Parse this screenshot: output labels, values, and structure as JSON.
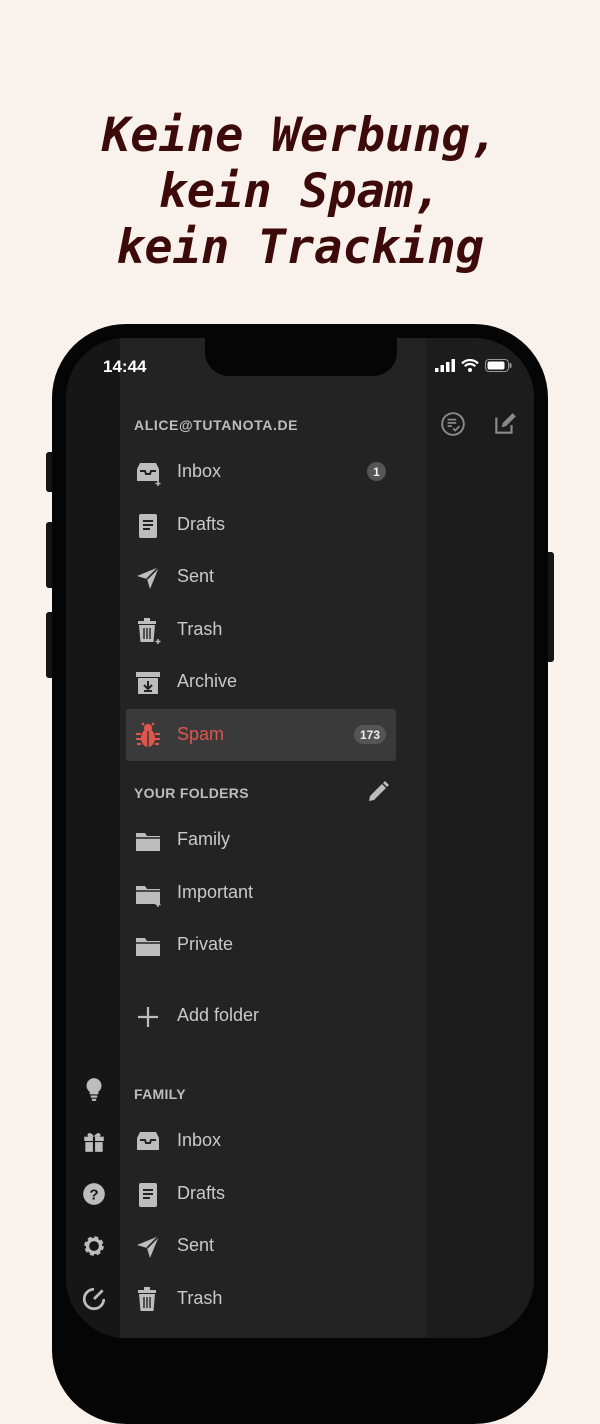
{
  "headline": {
    "line1": "Keine Werbung,",
    "line2": "kein Spam,",
    "line3": "kein Tracking"
  },
  "status_bar": {
    "time": "14:44"
  },
  "account": {
    "email": "ALICE@TUTANOTA.DE"
  },
  "system_folders": [
    {
      "label": "Inbox",
      "icon": "inbox-icon",
      "badge": "1"
    },
    {
      "label": "Drafts",
      "icon": "drafts-icon"
    },
    {
      "label": "Sent",
      "icon": "sent-icon"
    },
    {
      "label": "Trash",
      "icon": "trash-icon"
    },
    {
      "label": "Archive",
      "icon": "archive-icon"
    },
    {
      "label": "Spam",
      "icon": "spam-bug-icon",
      "badge": "173",
      "selected": true
    }
  ],
  "your_folders": {
    "title": "YOUR FOLDERS",
    "items": [
      {
        "label": "Family",
        "icon": "folder-icon"
      },
      {
        "label": "Important",
        "icon": "folder-icon"
      },
      {
        "label": "Private",
        "icon": "folder-icon"
      }
    ],
    "add_label": "Add folder"
  },
  "family_section": {
    "title": "FAMILY",
    "items": [
      {
        "label": "Inbox"
      },
      {
        "label": "Drafts"
      },
      {
        "label": "Sent"
      },
      {
        "label": "Trash"
      }
    ]
  },
  "colors": {
    "background": "#f9f1ec",
    "headline": "#3d0a0a",
    "selected_text": "#e0564d"
  }
}
